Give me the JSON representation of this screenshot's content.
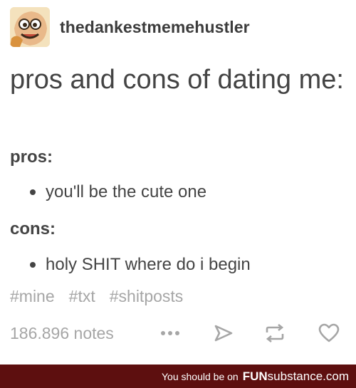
{
  "post": {
    "username": "thedankestmemehustler",
    "title": "pros and cons of dating me:",
    "pros_label": "pros:",
    "pros_items": [
      "you'll be the cute one"
    ],
    "cons_label": "cons:",
    "cons_items": [
      "holy SHIT where do i begin"
    ],
    "tags": [
      "#mine",
      "#txt",
      "#shitposts"
    ],
    "notes": "186.896 notes"
  },
  "icons": {
    "more": "more-dots-icon",
    "share": "share-arrow-icon",
    "reblog": "reblog-icon",
    "like": "heart-icon"
  },
  "banner": {
    "text": "You should be on",
    "brand_bold": "FUN",
    "brand_rest": "substance.com"
  },
  "colors": {
    "text": "#444444",
    "muted": "#a6a6a6",
    "banner_bg": "#5d0f0f"
  }
}
